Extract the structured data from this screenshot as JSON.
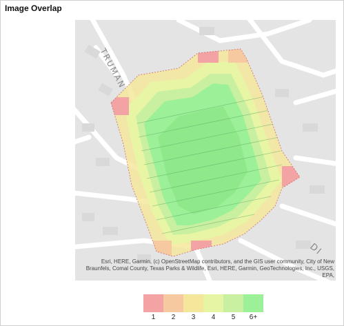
{
  "panel": {
    "title": "Image Overlap"
  },
  "map": {
    "street_label_1": "TRUMAN",
    "street_label_2": "DI",
    "attribution": "Esri, HERE, Garmin, (c) OpenStreetMap contributors, and the GIS user community, City of New Braunfels, Comal County, Texas Parks & Wildlife, Esri, HERE, Garmin, GeoTechnologies, Inc., USGS, EPA,"
  },
  "legend": {
    "items": [
      {
        "label": "1",
        "color": "#f3a3a3"
      },
      {
        "label": "2",
        "color": "#f6c9a0"
      },
      {
        "label": "3",
        "color": "#f4e79c"
      },
      {
        "label": "4",
        "color": "#e6f5a4"
      },
      {
        "label": "5",
        "color": "#c9f0a0"
      },
      {
        "label": "6+",
        "color": "#9cf098"
      }
    ]
  }
}
